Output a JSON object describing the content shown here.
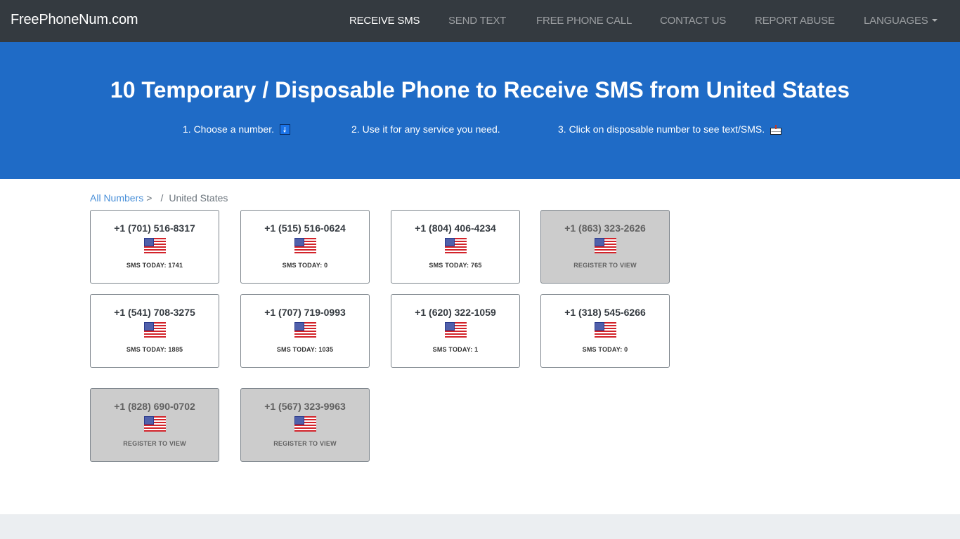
{
  "navbar": {
    "brand": "FreePhoneNum.com",
    "items": [
      {
        "label": "RECEIVE SMS",
        "active": true
      },
      {
        "label": "SEND TEXT",
        "active": false
      },
      {
        "label": "FREE PHONE CALL",
        "active": false
      },
      {
        "label": "CONTACT US",
        "active": false
      },
      {
        "label": "REPORT ABUSE",
        "active": false
      },
      {
        "label": "LANGUAGES",
        "active": false,
        "dropdown": true
      }
    ]
  },
  "hero": {
    "title": "10 Temporary / Disposable Phone to Receive SMS from United States",
    "steps": [
      {
        "text": "1. Choose a number.",
        "icon": "down-arrow-icon"
      },
      {
        "text": "2. Use it for any service you need.",
        "icon": null
      },
      {
        "text": "3. Click on disposable number to see text/SMS.",
        "icon": "mailbox-icon"
      }
    ],
    "background_color": "#1f6bc6"
  },
  "breadcrumb": {
    "link": "All Numbers",
    "separator": ">",
    "slash": "/",
    "current": "United States"
  },
  "numbers": [
    {
      "number": "+1 (701) 516-8317",
      "status": "SMS TODAY: 1741",
      "locked": false,
      "country_flag": "us-flag-icon"
    },
    {
      "number": "+1 (515) 516-0624",
      "status": "SMS TODAY: 0",
      "locked": false,
      "country_flag": "us-flag-icon"
    },
    {
      "number": "+1 (804) 406-4234",
      "status": "SMS TODAY: 765",
      "locked": false,
      "country_flag": "us-flag-icon"
    },
    {
      "number": "+1 (863) 323-2626",
      "status": "REGISTER TO VIEW",
      "locked": true,
      "country_flag": "us-flag-icon"
    },
    {
      "number": "+1 (541) 708-3275",
      "status": "SMS TODAY: 1885",
      "locked": false,
      "country_flag": "us-flag-icon"
    },
    {
      "number": "+1 (707) 719-0993",
      "status": "SMS TODAY: 1035",
      "locked": false,
      "country_flag": "us-flag-icon"
    },
    {
      "number": "+1 (620) 322-1059",
      "status": "SMS TODAY: 1",
      "locked": false,
      "country_flag": "us-flag-icon"
    },
    {
      "number": "+1 (318) 545-6266",
      "status": "SMS TODAY: 0",
      "locked": false,
      "country_flag": "us-flag-icon"
    },
    {
      "number": "+1 (828) 690-0702",
      "status": "REGISTER TO VIEW",
      "locked": true,
      "country_flag": "us-flag-icon"
    },
    {
      "number": "+1 (567) 323-9963",
      "status": "REGISTER TO VIEW",
      "locked": true,
      "country_flag": "us-flag-icon"
    }
  ]
}
